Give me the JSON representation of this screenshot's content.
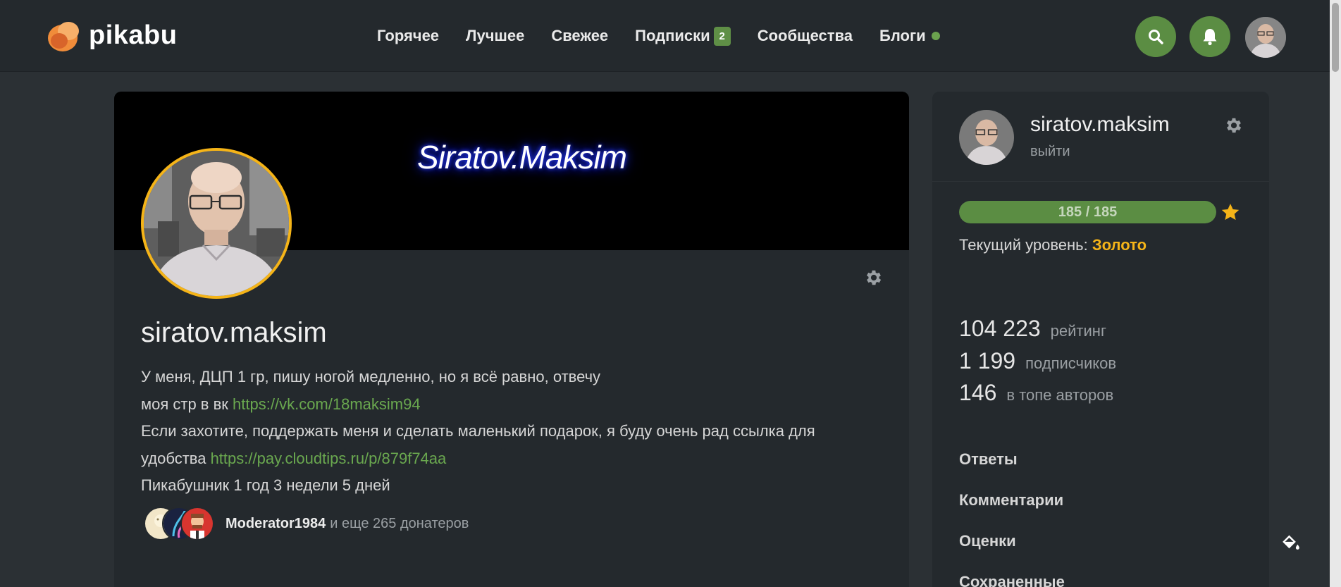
{
  "header": {
    "logo_text": "pikabu",
    "nav": [
      {
        "label": "Горячее"
      },
      {
        "label": "Лучшее"
      },
      {
        "label": "Свежее"
      },
      {
        "label": "Подписки",
        "badge": "2"
      },
      {
        "label": "Сообщества"
      },
      {
        "label": "Блоги"
      }
    ],
    "search_icon": "search-icon",
    "notifications_icon": "bell-icon",
    "accent_color": "#5b8d43"
  },
  "profile": {
    "banner_text": "Siratov.Maksim",
    "username": "siratov.maksim",
    "bio_line1": "У меня, ДЦП 1 гр, пишу ногой медленно, но я всё равно, отвечу",
    "bio_line2_prefix": "моя стр в вк ",
    "bio_link1": "https://vk.com/18maksim94",
    "bio_line3": "Если захотите, поддержать меня и сделать маленький подарок, я буду очень рад ссылка для удобства ",
    "bio_link2": "https://pay.cloudtips.ru/p/879f74aa",
    "member_since": "Пикабушник 1 год 3 недели 5 дней",
    "donor_name": "Moderator1984",
    "donor_more": "и еще 265 донатеров"
  },
  "sidebar": {
    "username": "siratov.maksim",
    "logout": "выйти",
    "progress_label": "185 / 185",
    "progress_value": 1.0,
    "level_prefix": "Текущий уровень: ",
    "level_value": "Золото",
    "stats": [
      {
        "value": "104 223",
        "label": "рейтинг"
      },
      {
        "value": "1 199",
        "label": "подписчиков"
      },
      {
        "value": "146",
        "label": "в топе авторов"
      }
    ],
    "links": [
      "Ответы",
      "Комментарии",
      "Оценки",
      "Сохраненные"
    ]
  }
}
